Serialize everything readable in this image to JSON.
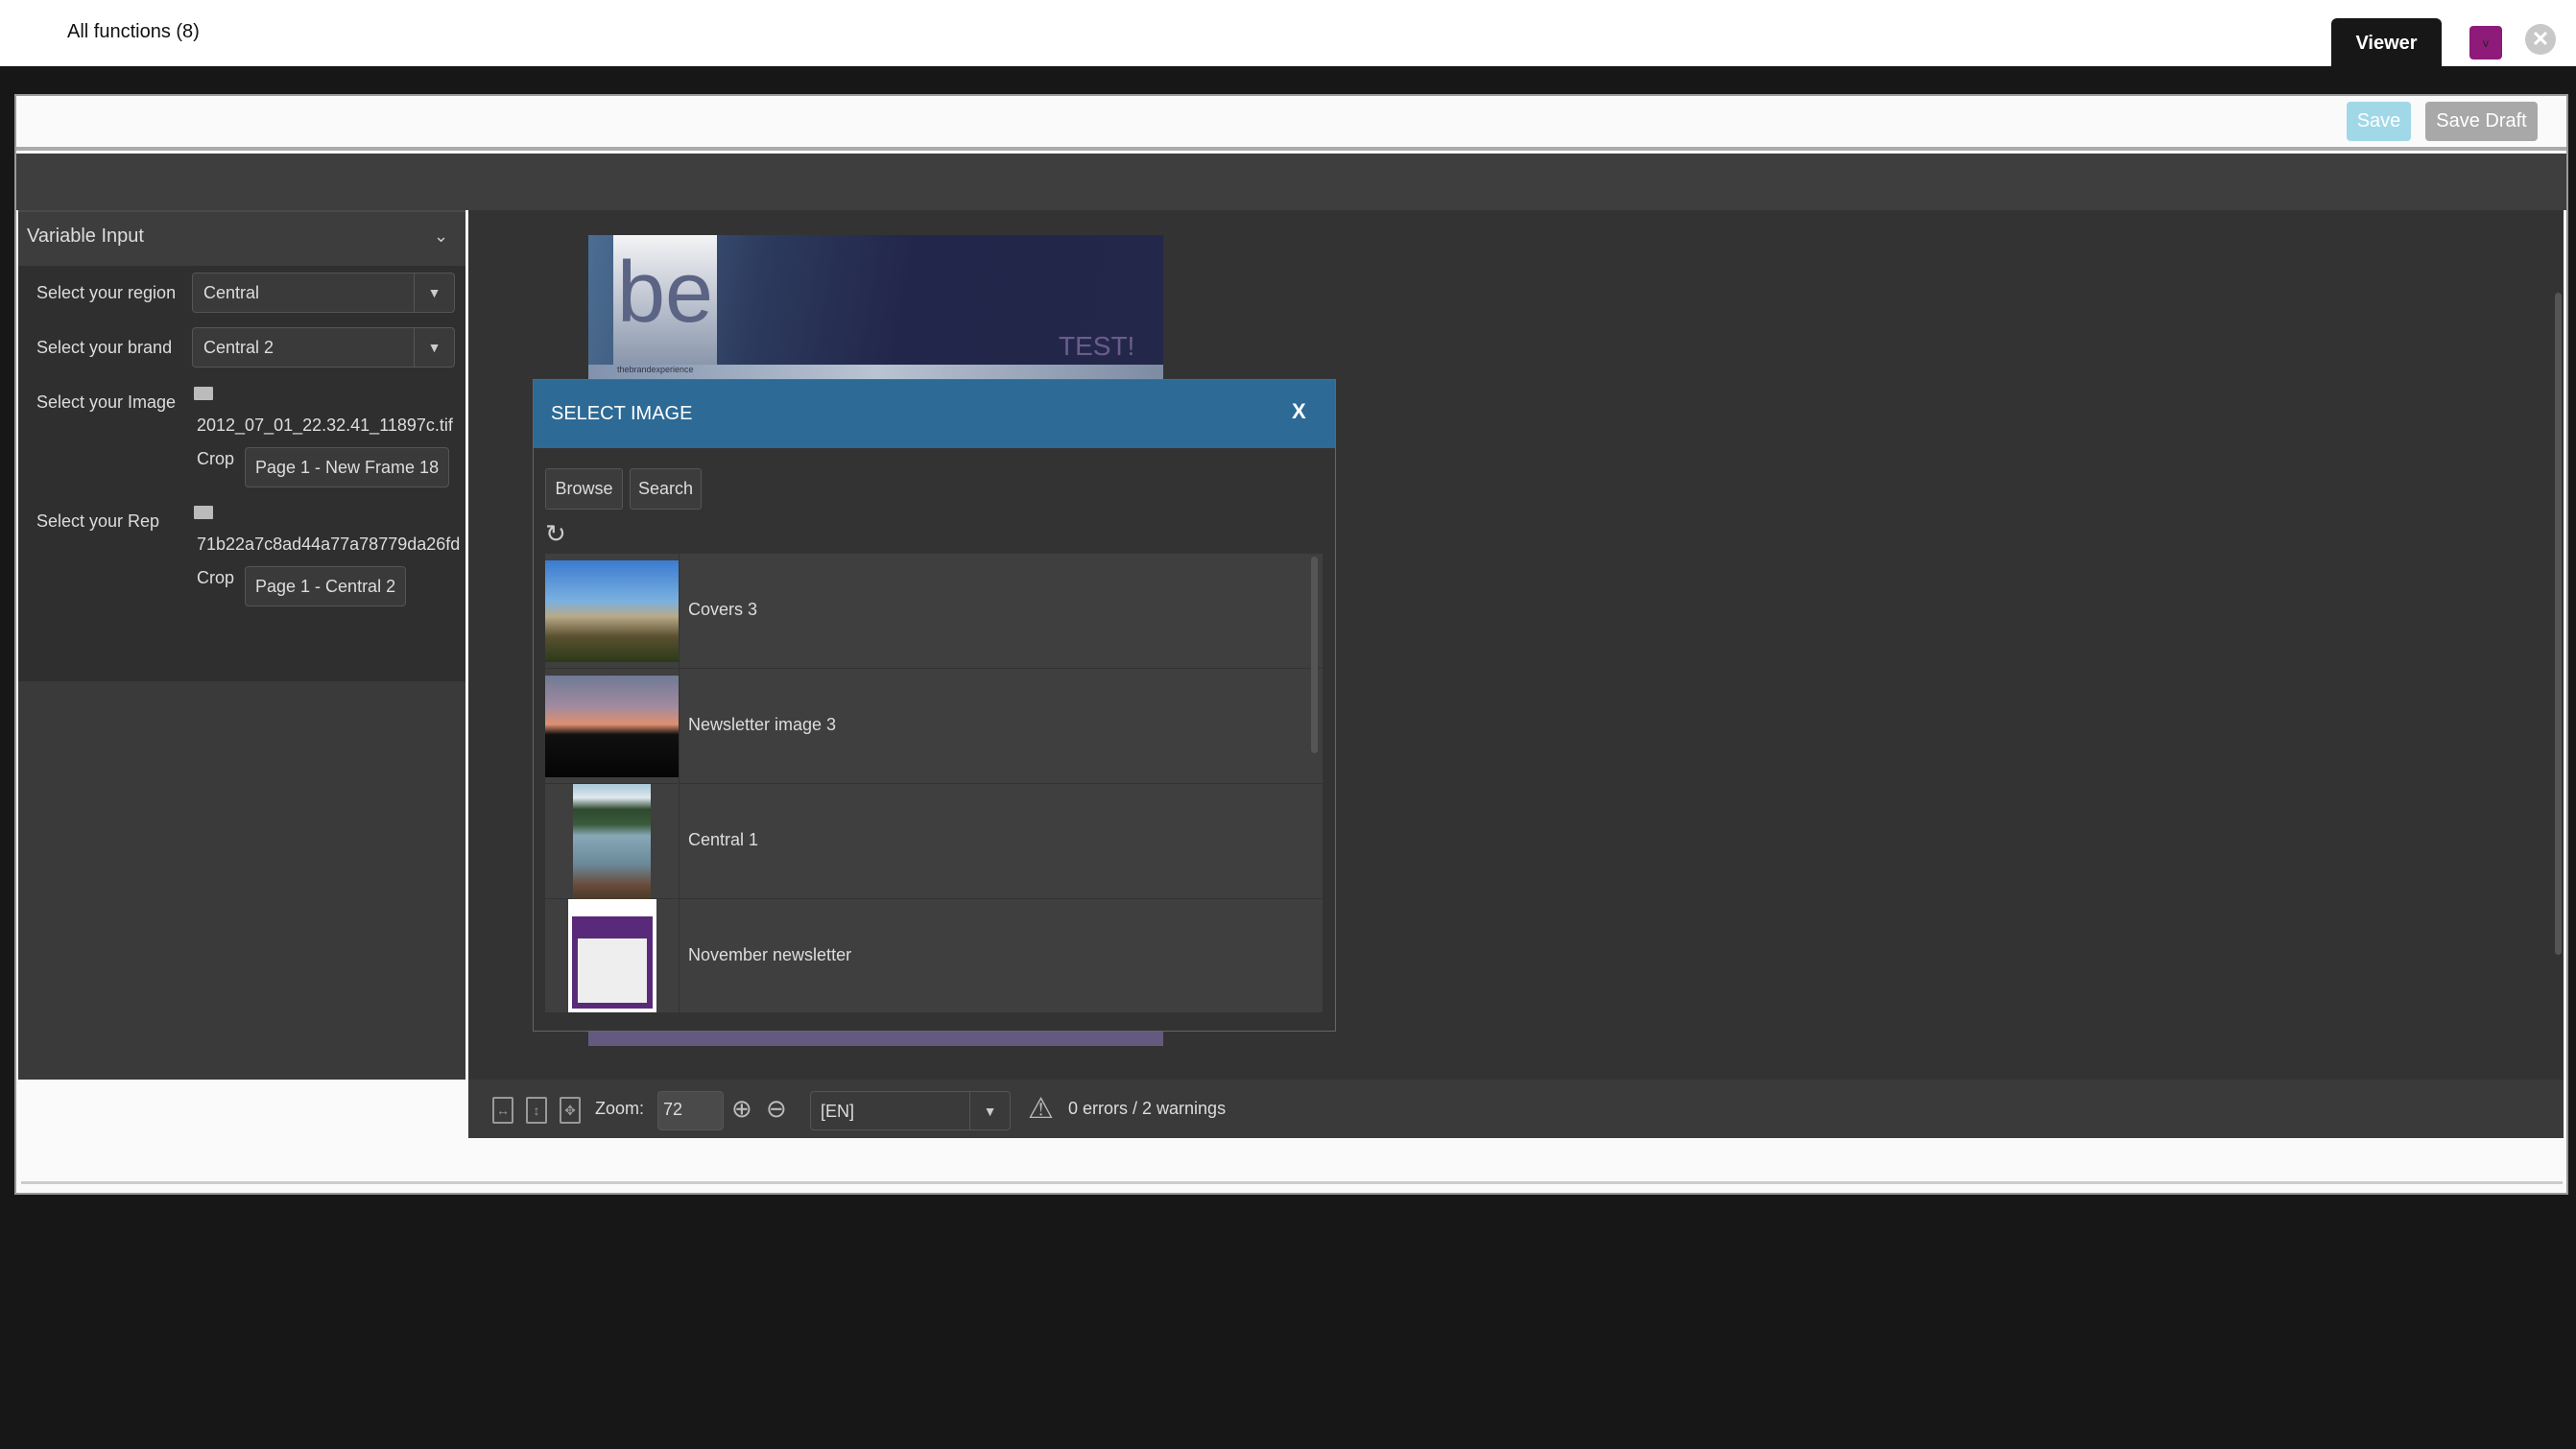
{
  "topbar": {
    "title": "All functions (8)",
    "viewer_tab": "Viewer",
    "menu_button": "v",
    "close": "✕"
  },
  "toolbar": {
    "save_label": "Save",
    "save_draft_label": "Save Draft"
  },
  "panel": {
    "title": "Variable Input",
    "region": {
      "label": "Select your region",
      "value": "Central"
    },
    "brand": {
      "label": "Select your brand",
      "value": "Central 2"
    },
    "image": {
      "label": "Select your Image",
      "filename": "2012_07_01_22.32.41_11897c.tif",
      "crop_label": "Crop",
      "crop_value": "Page 1 - New Frame 18"
    },
    "rep": {
      "label": "Select your Rep",
      "filename": "71b22a7c8ad44a77a78779da26fd",
      "crop_label": "Crop",
      "crop_value": "Page 1 - Central 2"
    }
  },
  "document": {
    "logo_text": "be",
    "tagline": "thebrandexperience",
    "banner_text": "TEST!"
  },
  "modal": {
    "title": "SELECT IMAGE",
    "close": "X",
    "browse": "Browse",
    "search": "Search",
    "items": [
      {
        "name": "Covers 3"
      },
      {
        "name": "Newsletter image 3"
      },
      {
        "name": "Central 1"
      },
      {
        "name": "November newsletter"
      }
    ]
  },
  "bottombar": {
    "zoom_label": "Zoom:",
    "zoom_value": "72",
    "language": "[EN]",
    "status": "0 errors / 2 warnings"
  },
  "colors": {
    "modal_header": "#2d6a96",
    "save": "#a0d8e8",
    "menu_button": "#8e1a7a"
  }
}
